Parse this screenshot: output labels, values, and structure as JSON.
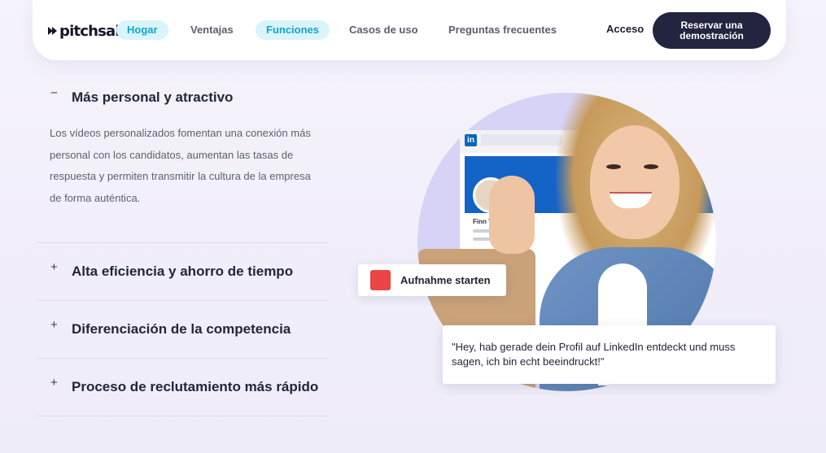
{
  "nav": {
    "logo_text": "pitchsail",
    "items": [
      {
        "label": "Hogar",
        "active": true
      },
      {
        "label": "Ventajas",
        "active": false
      },
      {
        "label": "Funciones",
        "active": true
      },
      {
        "label": "Casos de uso",
        "active": false
      },
      {
        "label": "Preguntas frecuentes",
        "active": false
      }
    ],
    "login_label": "Acceso",
    "demo_button_label": "Reservar una demostración"
  },
  "accordion": {
    "items": [
      {
        "title": "Más personal y atractivo",
        "toggle": "−",
        "expanded": true,
        "body": "Los vídeos personalizados fomentan una conexión más personal con los candidatos, aumentan las tasas de respuesta y permiten transmitir la cultura de la empresa de forma auténtica."
      },
      {
        "title": "Alta eficiencia y ahorro de tiempo",
        "toggle": "+",
        "expanded": false
      },
      {
        "title": "Diferenciación de la competencia",
        "toggle": "+",
        "expanded": false
      },
      {
        "title": "Proceso de reclutamiento más rápido",
        "toggle": "+",
        "expanded": false
      }
    ]
  },
  "hero": {
    "linkedin_logo": "in",
    "profile_name": "Finn V",
    "record_label": "Aufnahme starten",
    "quote": "\"Hey, hab gerade dein Profil auf LinkedIn entdeckt und muss sagen, ich bin echt beeindruckt!\""
  },
  "colors": {
    "accent": "#12a6c9",
    "accent_bg": "#d9f5fa",
    "button_dark": "#23243f",
    "record_red": "#ea4646",
    "linkedin_blue": "#1464c8"
  }
}
